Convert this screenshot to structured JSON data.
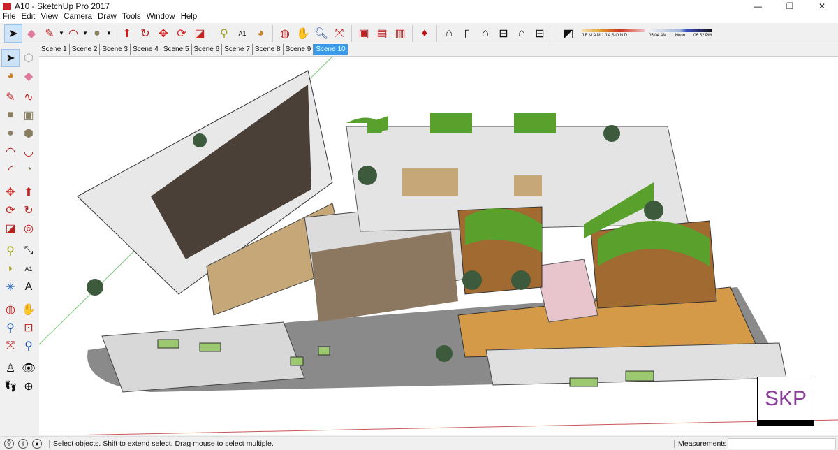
{
  "window": {
    "title": "A10 - SketchUp Pro 2017",
    "minimize": "—",
    "maximize": "❐",
    "close": "✕"
  },
  "menu": [
    "File",
    "Edit",
    "View",
    "Camera",
    "Draw",
    "Tools",
    "Window",
    "Help"
  ],
  "toolbar": {
    "icons": [
      "select-icon",
      "eraser-icon",
      "pencil-icon",
      "arc-icon",
      "circle-icon",
      "push-pull-icon",
      "follow-me-icon",
      "move-icon",
      "rotate-icon",
      "scale-icon",
      "tape-measure-icon",
      "text-icon",
      "paint-bucket-icon",
      "orbit-icon",
      "pan-icon",
      "zoom-icon",
      "zoom-extents-icon",
      "warehouse-icon",
      "share-model-icon",
      "extension-icon",
      "ruby-icon",
      "iso-view-icon",
      "top-view-icon",
      "front-view-icon",
      "right-view-icon",
      "back-view-icon",
      "left-view-icon",
      "shadows-icon"
    ]
  },
  "shadow": {
    "months": "J F M A M J J A S O N D",
    "time_start": "05:04 AM",
    "time_mid": "Noon",
    "time_end": "06:52 PM",
    "month_value": 0.33,
    "time_value": 0.5
  },
  "scenes": {
    "tabs": [
      "Scene 1",
      "Scene 2",
      "Scene 3",
      "Scene 4",
      "Scene 5",
      "Scene 6",
      "Scene 7",
      "Scene 8",
      "Scene 9",
      "Scene 10"
    ],
    "active": "Scene 10"
  },
  "status": {
    "message": "Select objects. Shift to extend select. Drag mouse to select multiple.",
    "measurements_label": "Measurements",
    "measurements_value": ""
  },
  "watermark": {
    "text": "SKP"
  },
  "colors": {
    "accent": "#3c9ae8",
    "roof_green": "#5aa02c",
    "wood": "#c98a3e"
  }
}
